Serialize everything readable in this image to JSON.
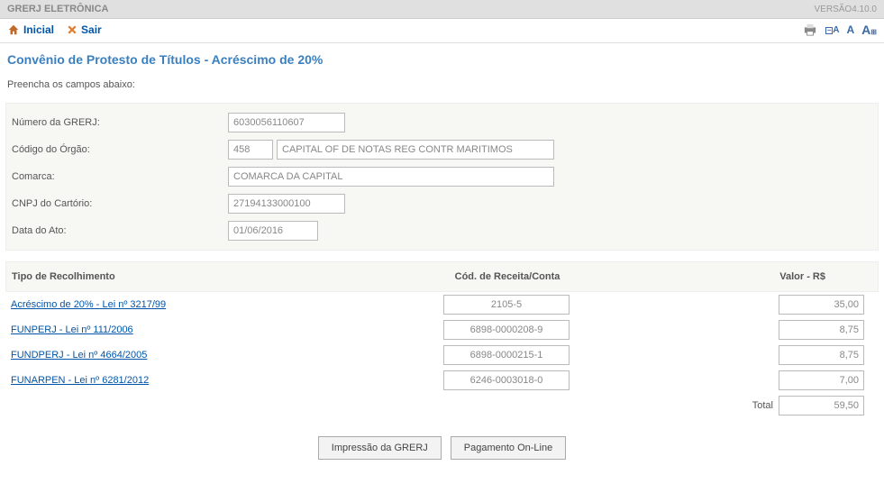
{
  "header": {
    "app_title": "GRERJ ELETRÔNICA",
    "version": "VERSÃO4.10.0"
  },
  "nav": {
    "home": "Inicial",
    "exit": "Sair"
  },
  "page": {
    "title": "Convênio de Protesto de Títulos - Acréscimo de 20%",
    "intro": "Preencha os campos abaixo:"
  },
  "form": {
    "grerj_label": "Número da GRERJ:",
    "grerj_value": "6030056110607",
    "orgao_label": "Código do Órgão:",
    "orgao_code": "458",
    "orgao_name": "CAPITAL OF DE NOTAS REG CONTR MARITIMOS",
    "comarca_label": "Comarca:",
    "comarca_value": "COMARCA DA CAPITAL",
    "cnpj_label": "CNPJ do Cartório:",
    "cnpj_value": "27194133000100",
    "data_label": "Data do Ato:",
    "data_value": "01/06/2016"
  },
  "table": {
    "headers": {
      "tipo": "Tipo de Recolhimento",
      "cod": "Cód. de Receita/Conta",
      "valor": "Valor - R$"
    },
    "rows": [
      {
        "tipo": "Acréscimo de 20% - Lei nº 3217/99",
        "cod": "2105-5",
        "valor": "35,00"
      },
      {
        "tipo": "FUNPERJ - Lei nº 111/2006",
        "cod": "6898-0000208-9",
        "valor": "8,75"
      },
      {
        "tipo": "FUNDPERJ - Lei nº 4664/2005",
        "cod": "6898-0000215-1",
        "valor": "8,75"
      },
      {
        "tipo": "FUNARPEN - Lei nº 6281/2012",
        "cod": "6246-0003018-0",
        "valor": "7,00"
      }
    ],
    "total_label": "Total",
    "total_value": "59,50"
  },
  "actions": {
    "print": "Impressão da GRERJ",
    "pay": "Pagamento On-Line"
  }
}
